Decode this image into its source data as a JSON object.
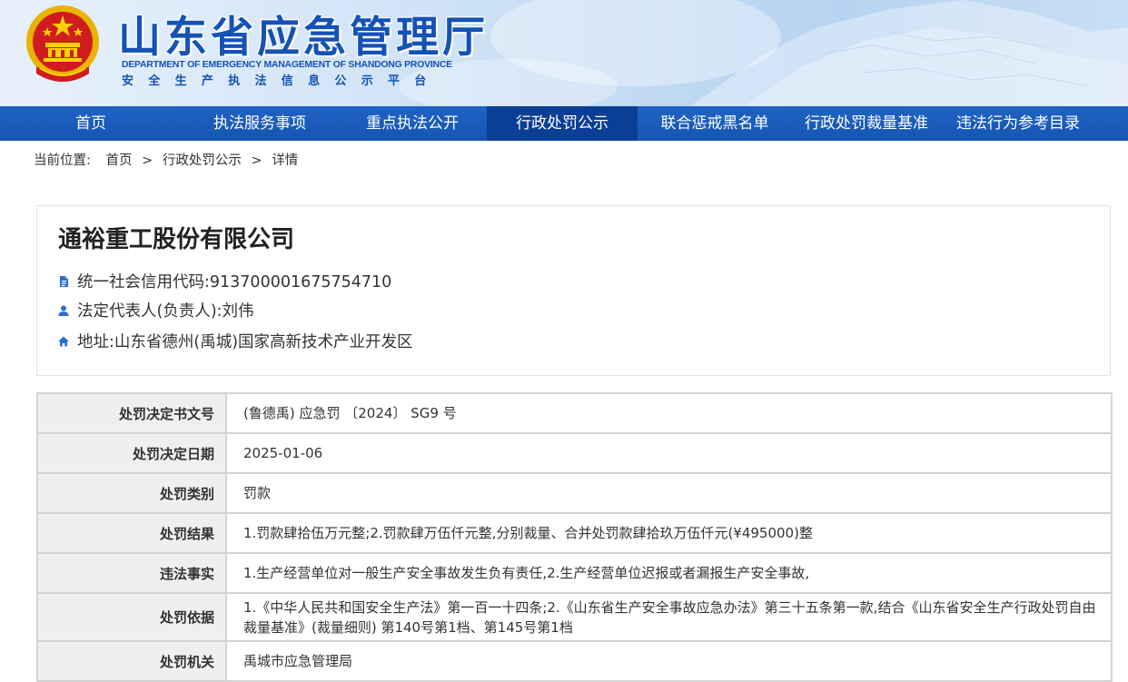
{
  "header": {
    "title": "山东省应急管理厅",
    "title_en": "DEPARTMENT OF EMERGENCY MANAGEMENT OF SHANDONG PROVINCE",
    "subtitle": "安全生产执法信息公示平台",
    "emblem_icon": "national-emblem-icon",
    "brand_color": "#1552b6"
  },
  "nav": {
    "items": [
      {
        "label": "首页"
      },
      {
        "label": "执法服务事项"
      },
      {
        "label": "重点执法公开"
      },
      {
        "label": "行政处罚公示"
      },
      {
        "label": "联合惩戒黑名单"
      },
      {
        "label": "行政处罚裁量基准"
      },
      {
        "label": "违法行为参考目录"
      }
    ],
    "active_index": 3,
    "bar_color": "#1655b3",
    "active_color": "#0b3f95"
  },
  "breadcrumb": {
    "label": "当前位置:",
    "items": [
      "首页",
      "行政处罚公示",
      "详情"
    ],
    "separator": ">"
  },
  "company": {
    "name": "通裕重工股份有限公司",
    "credit_code": "统一社会信用代码:913700001675754710",
    "legal_rep": "法定代表人(负责人):刘伟",
    "address": "地址:山东省德州(禹城)国家高新技术产业开发区",
    "icons": [
      "document-icon",
      "user-icon",
      "home-icon"
    ]
  },
  "details": {
    "rows": [
      {
        "label": "处罚决定书文号",
        "value": "(鲁德禹) 应急罚 〔2024〕 SG9 号"
      },
      {
        "label": "处罚决定日期",
        "value": "2025-01-06"
      },
      {
        "label": "处罚类别",
        "value": "罚款"
      },
      {
        "label": "处罚结果",
        "value": "1.罚款肆拾伍万元整;2.罚款肆万伍仟元整,分别裁量、合并处罚款肆拾玖万伍仟元(¥495000)整"
      },
      {
        "label": "违法事实",
        "value": "1.生产经营单位对一般生产安全事故发生负有责任,2.生产经营单位迟报或者漏报生产安全事故,"
      },
      {
        "label": "处罚依据",
        "value": "1.《中华人民共和国安全生产法》第一百一十四条;2.《山东省生产安全事故应急办法》第三十五条第一款,结合《山东省安全生产行政处罚自由裁量基准》(裁量细则) 第140号第1档、第145号第1档"
      },
      {
        "label": "处罚机关",
        "value": "禹城市应急管理局"
      }
    ]
  }
}
